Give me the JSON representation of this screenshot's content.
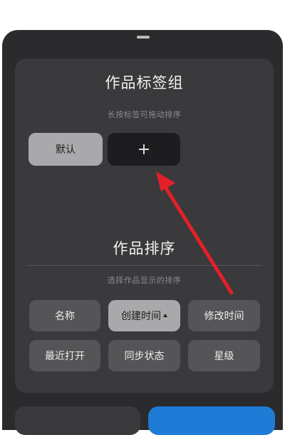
{
  "tag_group": {
    "title": "作品标签组",
    "hint": "长按标签可拖动排序",
    "tags": [
      {
        "label": "默认"
      }
    ],
    "add_label": "+"
  },
  "sort": {
    "title": "作品排序",
    "hint": "选择作品显示的排序",
    "options": [
      {
        "label": "名称"
      },
      {
        "label": "创建时间",
        "active": true
      },
      {
        "label": "修改时间"
      },
      {
        "label": "最近打开"
      },
      {
        "label": "同步状态"
      },
      {
        "label": "星级"
      }
    ]
  },
  "colors": {
    "sheet": "#2b2b2d",
    "card": "#3a3a3c",
    "chip_active": "#a9a9ab",
    "chip": "#555558",
    "confirm_button": "#1e7bd6",
    "annotation_arrow": "#e3202a"
  },
  "icons": {
    "add": "plus-icon",
    "sort_direction": "caret-up-icon",
    "annotation": "red-arrow-icon"
  }
}
